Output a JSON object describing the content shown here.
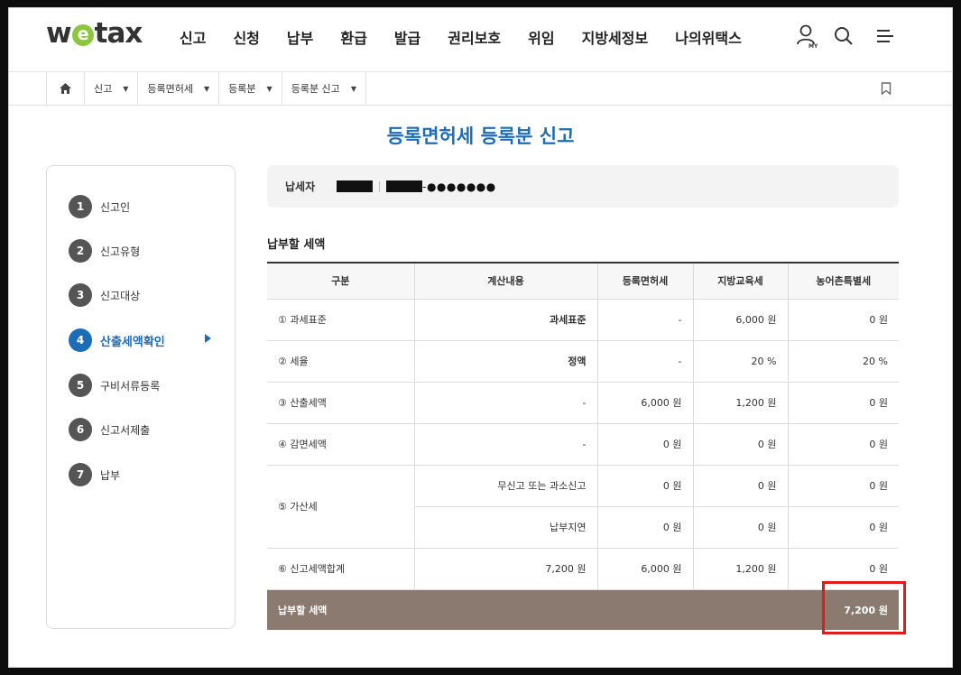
{
  "header": {
    "logo": {
      "pre": "w",
      "mid": "e",
      "post": "tax"
    },
    "menu": [
      "신고",
      "신청",
      "납부",
      "환급",
      "발급",
      "권리보호",
      "위임",
      "지방세정보",
      "나의위택스"
    ],
    "icons": [
      "my-page-icon",
      "search-icon",
      "hamburger-menu-icon"
    ],
    "my_label": "MY"
  },
  "breadcrumb": {
    "items": [
      "신고",
      "등록면허세",
      "등록분",
      "등록분 신고"
    ]
  },
  "page_title": "등록면허세 등록분 신고",
  "steps": [
    {
      "num": "1",
      "label": "신고인"
    },
    {
      "num": "2",
      "label": "신고유형"
    },
    {
      "num": "3",
      "label": "신고대상"
    },
    {
      "num": "4",
      "label": "산출세액확인",
      "active": true
    },
    {
      "num": "5",
      "label": "구비서류등록"
    },
    {
      "num": "6",
      "label": "신고서제출"
    },
    {
      "num": "7",
      "label": "납부"
    }
  ],
  "taxpayer": {
    "label": "납세자",
    "id_suffix": "-●●●●●●●"
  },
  "section_title": "납부할 세액",
  "table": {
    "headers": [
      "구분",
      "계산내용",
      "등록면허세",
      "지방교육세",
      "농어촌특별세"
    ],
    "rows": [
      {
        "cat": "① 과세표준",
        "calc": "과세표준",
        "reg": "-",
        "edu": "6,000 원",
        "rural": "0 원"
      },
      {
        "cat": "② 세율",
        "calc": "정액",
        "reg": "-",
        "edu": "20 %",
        "rural": "20 %"
      },
      {
        "cat": "③ 산출세액",
        "calc": "-",
        "reg": "6,000 원",
        "edu": "1,200 원",
        "rural": "0 원"
      },
      {
        "cat": "④ 감면세액",
        "calc": "-",
        "reg": "0 원",
        "edu": "0 원",
        "rural": "0 원"
      }
    ],
    "penalty": {
      "cat": "⑤ 가산세",
      "rows": [
        {
          "calc": "무신고 또는 과소신고",
          "reg": "0 원",
          "edu": "0 원",
          "rural": "0 원"
        },
        {
          "calc": "납부지연",
          "reg": "0 원",
          "edu": "0 원",
          "rural": "0 원"
        }
      ]
    },
    "sum": {
      "cat": "⑥ 신고세액합계",
      "calc": "7,200 원",
      "reg": "6,000 원",
      "edu": "1,200 원",
      "rural": "0 원"
    },
    "total": {
      "label": "납부할 세액",
      "value": "7,200 원"
    }
  },
  "colors": {
    "accent": "#1d6cb7",
    "total_row": "#8a7a70",
    "highlight": "#e01b1b"
  }
}
